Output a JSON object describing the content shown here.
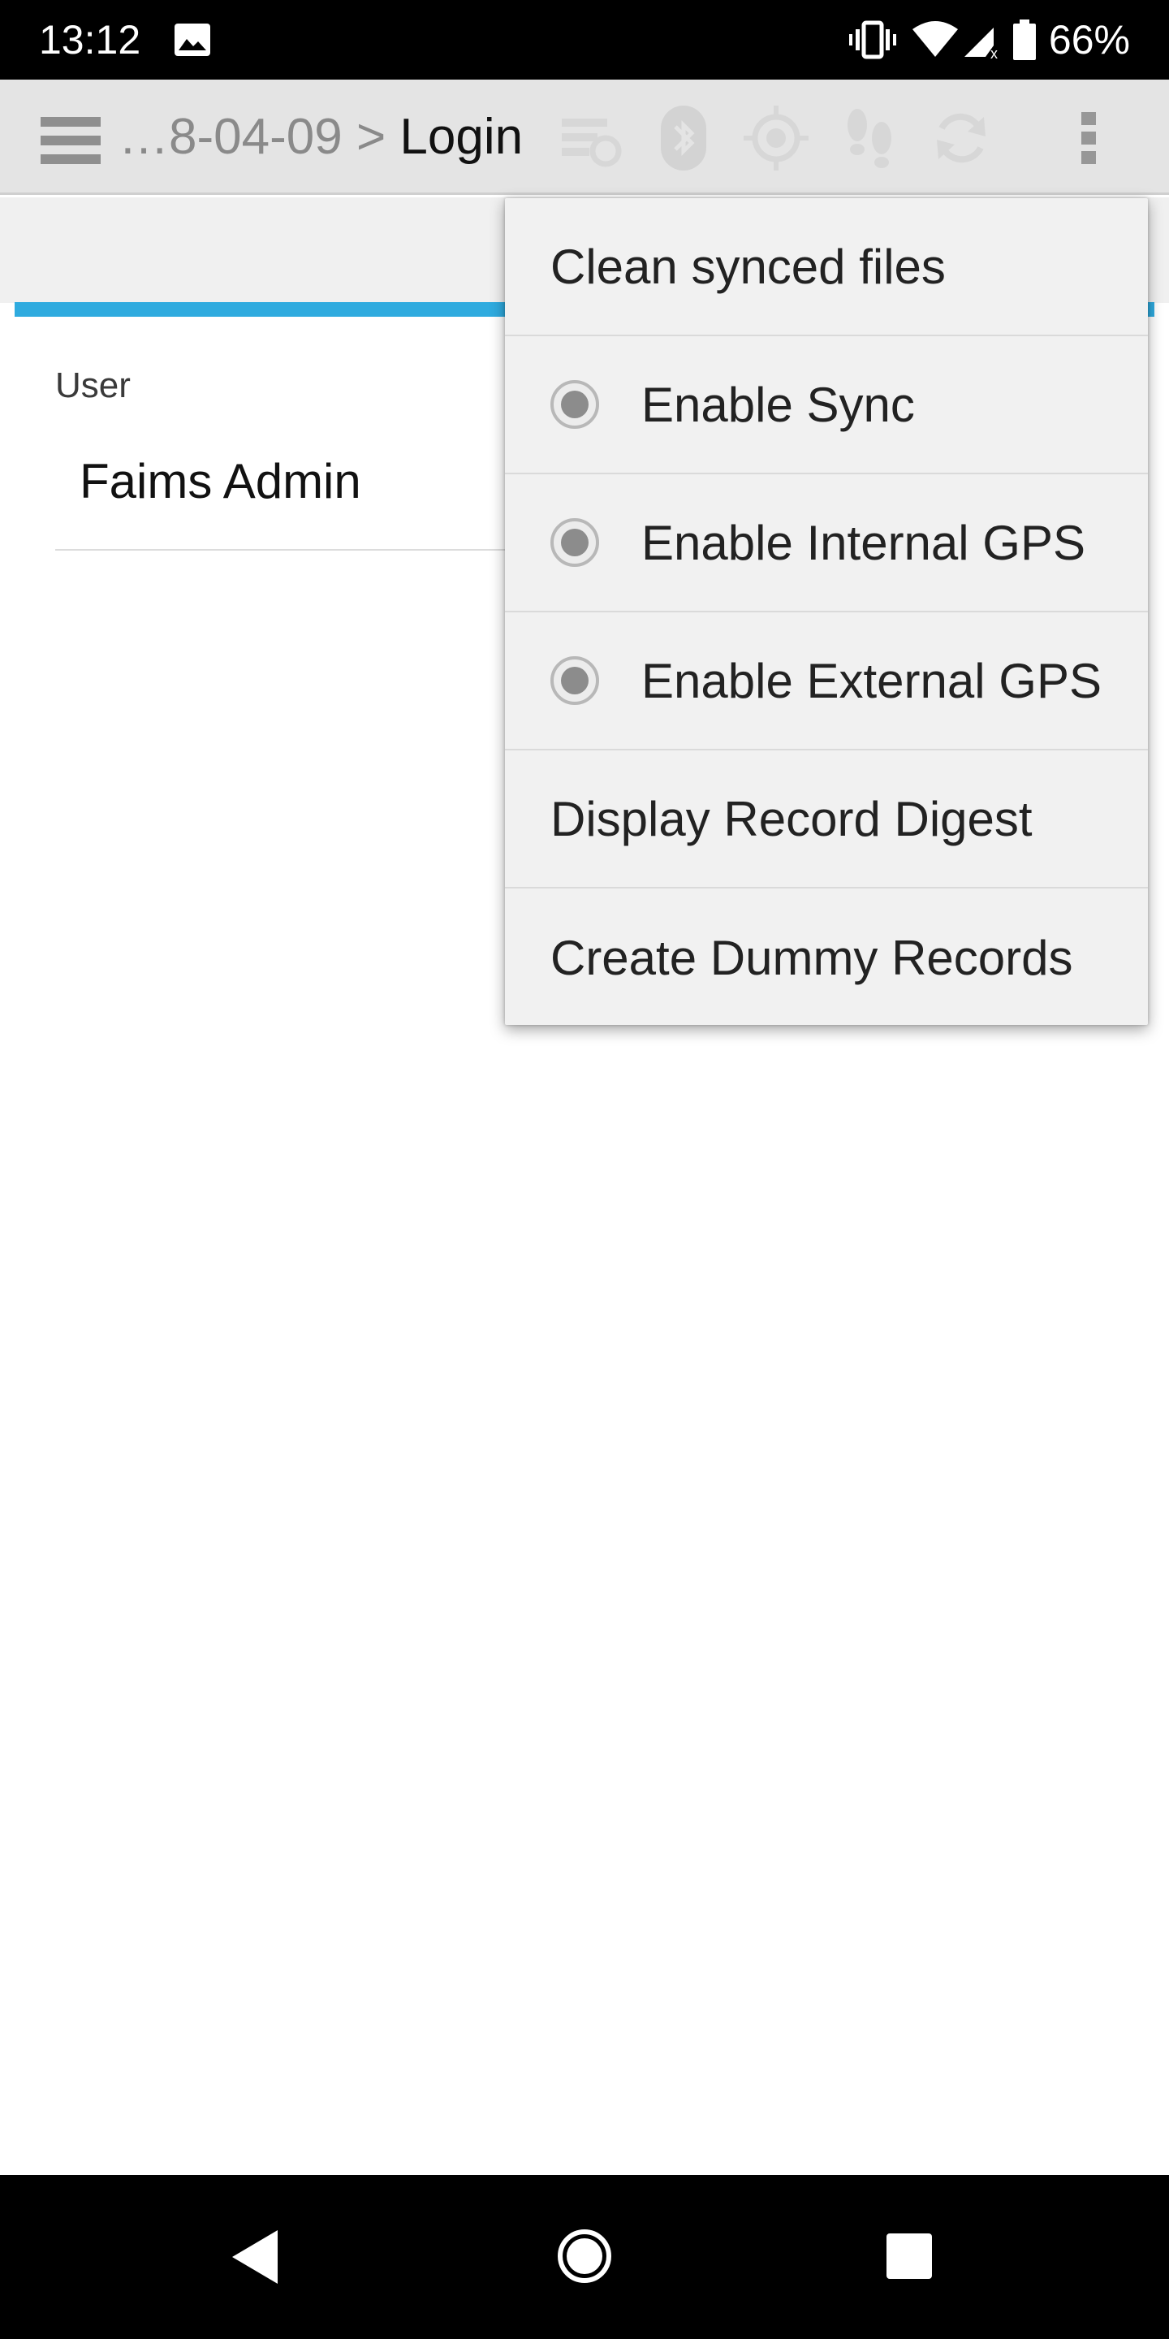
{
  "status_bar": {
    "time": "13:12",
    "battery_percent": "66%",
    "icons": [
      "image-icon",
      "vibrate-icon",
      "wifi-icon",
      "cell-signal-icon",
      "battery-icon"
    ]
  },
  "toolbar": {
    "breadcrumb_prev": "…8-04-09",
    "breadcrumb_sep": ">",
    "breadcrumb_current": "Login",
    "icons": [
      "hamburger-menu-icon",
      "sync-status-icon",
      "bluetooth-icon",
      "gps-target-icon",
      "footsteps-icon",
      "refresh-icon",
      "overflow-menu-icon"
    ]
  },
  "form": {
    "user_label": "User",
    "user_value": "Faims Admin"
  },
  "overflow_menu": {
    "items": [
      {
        "label": "Clean synced files",
        "type": "plain"
      },
      {
        "label": "Enable Sync",
        "type": "radio"
      },
      {
        "label": "Enable Internal GPS",
        "type": "radio"
      },
      {
        "label": "Enable External GPS",
        "type": "radio"
      },
      {
        "label": "Display Record Digest",
        "type": "plain"
      },
      {
        "label": "Create Dummy Records",
        "type": "plain"
      }
    ]
  },
  "colors": {
    "tab_indicator": "#2fabdf",
    "toolbar_bg": "#e4e4e4",
    "menu_bg": "#f1f1f1"
  },
  "nav_bar": {
    "icons": [
      "back-icon",
      "home-icon",
      "recents-icon"
    ]
  }
}
